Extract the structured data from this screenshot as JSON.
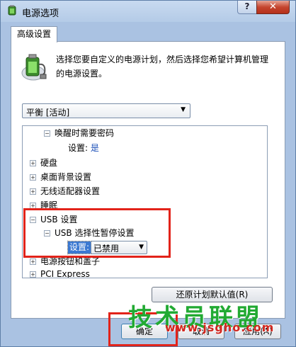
{
  "window": {
    "title": "电源选项",
    "help_label": "?",
    "close_label": "✕",
    "app_icon": "power-options-icon"
  },
  "tabs": [
    {
      "label": "高级设置"
    }
  ],
  "description": "选择您要自定义的电源计划，然后选择您希望计算机管理的电源设置。",
  "plan_select": {
    "value": "平衡 [活动]"
  },
  "tree": {
    "wakeup_password": {
      "label": "唤醒时需要密码",
      "setting_label": "设置:",
      "setting_value": "是"
    },
    "items": [
      {
        "label": "硬盘"
      },
      {
        "label": "桌面背景设置"
      },
      {
        "label": "无线适配器设置"
      },
      {
        "label": "睡眠"
      }
    ],
    "usb": {
      "label": "USB 设置",
      "suspend": {
        "label": "USB 选择性暂停设置",
        "setting_label": "设置:",
        "setting_value": "已禁用"
      }
    },
    "power_buttons": {
      "label": "电源按钮和盖子"
    },
    "pci_express": {
      "label": "PCI Express"
    }
  },
  "buttons": {
    "restore_defaults": "还原计划默认值(R)",
    "ok": "确定",
    "cancel": "取消",
    "apply": "应用(A)"
  },
  "watermark": {
    "text": "技术员联盟",
    "url": "www.jsgho.com"
  },
  "colors": {
    "highlight": "#e2231a",
    "selection": "#3a78d1",
    "link": "#1b4fb8"
  }
}
